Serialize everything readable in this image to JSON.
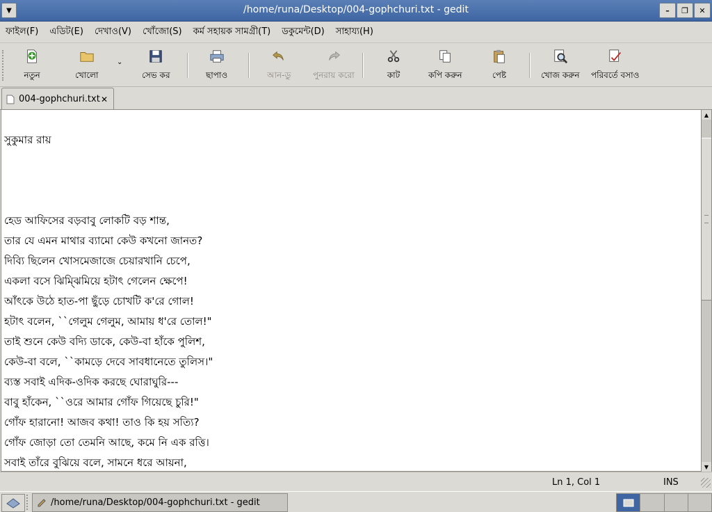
{
  "window": {
    "title": "/home/runa/Desktop/004-gophchuri.txt - gedit"
  },
  "menubar": [
    {
      "label": "ফাইল(F)"
    },
    {
      "label": "এডিট(E)"
    },
    {
      "label": "দেখাও(V)"
    },
    {
      "label": "খোঁজো(S)"
    },
    {
      "label": "কর্ম সহায়ক সামগ্রী(T)"
    },
    {
      "label": "ডকুমেন্ট(D)"
    },
    {
      "label": "সাহায্য(H)"
    }
  ],
  "toolbar": {
    "new": "নতুন",
    "open": "খোলো",
    "save": "সেভ কর",
    "print": "ছাপাও",
    "undo": "আন-ডু",
    "redo": "পুনরায় করো",
    "cut": "কাট",
    "copy": "কপি করুন",
    "paste": "পেষ্ট",
    "find": "খোজ করুন",
    "replace": "পরিবর্তে বসাও"
  },
  "tab": {
    "name": "004-gophchuri.txt"
  },
  "editor": {
    "lines": [
      "",
      "সুকুমার রায়",
      "",
      "",
      "",
      "হেড আফিসের বড়বাবু লোকটি বড় শান্ত,",
      "তার যে এমন মাথার ব্যামো কেউ কখনো জানত?",
      "দিব্যি ছিলেন খোসমেজাজে চেয়ারখানি চেপে,",
      "একলা বসে ঝিম্ঝিমিয়ে হটাৎ গেলেন ক্ষেপে!",
      "আঁৎকে উঠে হাত-পা ছুঁড়ে চোখটি ক'রে গোল!",
      "হটাৎ বলেন, ``গেলুম গেলুম, আমায় ধ'রে তোল!\"",
      "তাই শুনে কেউ বদ্যি ডাকে, কেউ-বা হাঁকে পুলিশ,",
      "কেউ-বা বলে, ``কামড়ে দেবে সাবধানেতে তুলিস।\"",
      "ব্যস্ত সবাই এদিক-ওদিক করছে ঘোরাঘুরি---",
      "বাবু হাঁকেন, ``ওরে আমার গোঁফ গিয়েছে চুরি!\"",
      "গোঁফ হারানো! আজব কথা! তাও কি হয় সত্যি?",
      "গোঁফ জোড়া তো তেমনি আছে, কমে নি এক রত্তি।",
      "সবাই তাঁরে বুঝিয়ে বলে, সামনে ধরে আয়না,"
    ]
  },
  "statusbar": {
    "position": "Ln 1, Col 1",
    "mode": "INS"
  },
  "taskbar": {
    "task_title": "/home/runa/Desktop/004-gophchuri.txt - gedit"
  }
}
